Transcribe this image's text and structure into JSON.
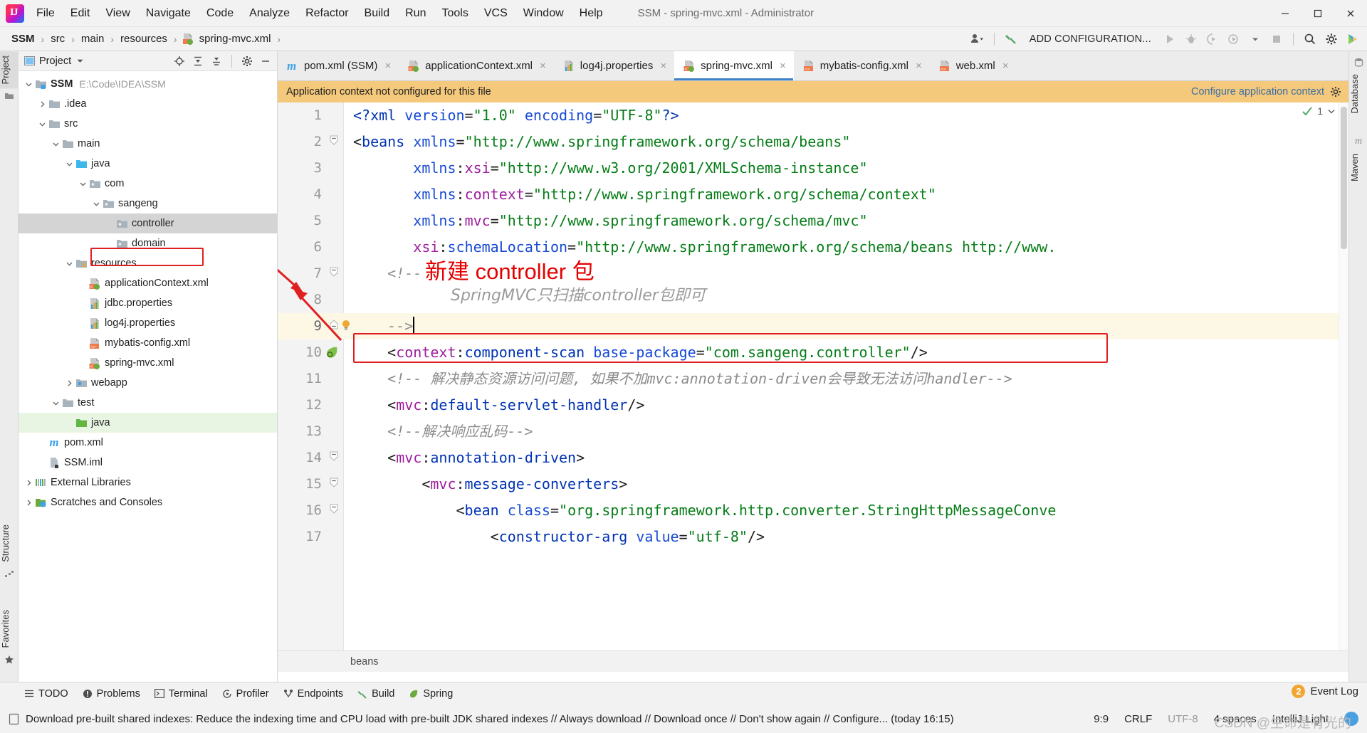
{
  "window": {
    "title": "SSM - spring-mvc.xml - Administrator",
    "logo_icon": "intellij-idea-logo",
    "minimize_icon": "minimize-icon",
    "maximize_icon": "maximize-icon",
    "close_icon": "close-icon"
  },
  "menubar": {
    "items": [
      "File",
      "Edit",
      "View",
      "Navigate",
      "Code",
      "Analyze",
      "Refactor",
      "Build",
      "Run",
      "Tools",
      "VCS",
      "Window",
      "Help"
    ]
  },
  "navbar": {
    "breadcrumbs": [
      "SSM",
      "src",
      "main",
      "resources",
      "spring-mvc.xml"
    ],
    "file_icon": "xml-spring-file-icon",
    "add_configuration_label": "ADD CONFIGURATION...",
    "icons": [
      "user-dropdown-icon",
      "hammer-build-icon",
      "run-icon",
      "debug-icon",
      "run-with-coverage-icon",
      "profile-icon",
      "stop-icon",
      "search-everywhere-icon",
      "settings-gear-icon",
      "ide-updates-icon"
    ]
  },
  "left_strip": {
    "tabs": [
      "Project",
      "Structure",
      "Favorites"
    ],
    "active_tab": "Project",
    "icons": [
      "project-folder-icon",
      "structure-icon",
      "favorites-star-icon"
    ]
  },
  "right_strip": {
    "tabs": [
      "Database",
      "Maven"
    ]
  },
  "project_panel": {
    "header_title": "Project",
    "header_icons": [
      "select-opened-file-icon",
      "expand-all-icon",
      "collapse-all-icon",
      "settings-gear-icon",
      "hide-icon"
    ],
    "tree": [
      {
        "label": "SSM",
        "path": "E:\\Code\\IDEA\\SSM",
        "depth": 0,
        "arrow": "down",
        "icon": "module-icon",
        "bold": true,
        "state": "none"
      },
      {
        "label": ".idea",
        "path": "",
        "depth": 1,
        "arrow": "right",
        "icon": "folder-icon",
        "bold": false,
        "state": "none"
      },
      {
        "label": "src",
        "path": "",
        "depth": 1,
        "arrow": "down",
        "icon": "folder-icon",
        "bold": false,
        "state": "none"
      },
      {
        "label": "main",
        "path": "",
        "depth": 2,
        "arrow": "down",
        "icon": "folder-icon",
        "bold": false,
        "state": "none"
      },
      {
        "label": "java",
        "path": "",
        "depth": 3,
        "arrow": "down",
        "icon": "source-root-icon",
        "bold": false,
        "state": "none"
      },
      {
        "label": "com",
        "path": "",
        "depth": 4,
        "arrow": "down",
        "icon": "package-icon",
        "bold": false,
        "state": "none"
      },
      {
        "label": "sangeng",
        "path": "",
        "depth": 5,
        "arrow": "down",
        "icon": "package-icon",
        "bold": false,
        "state": "none"
      },
      {
        "label": "controller",
        "path": "",
        "depth": 6,
        "arrow": "none",
        "icon": "package-icon",
        "bold": false,
        "state": "selected"
      },
      {
        "label": "domain",
        "path": "",
        "depth": 6,
        "arrow": "none",
        "icon": "package-icon",
        "bold": false,
        "state": "none"
      },
      {
        "label": "resources",
        "path": "",
        "depth": 3,
        "arrow": "down",
        "icon": "resource-root-icon",
        "bold": false,
        "state": "none"
      },
      {
        "label": "applicationContext.xml",
        "path": "",
        "depth": 4,
        "arrow": "none",
        "icon": "xml-spring-file-icon",
        "bold": false,
        "state": "none"
      },
      {
        "label": "jdbc.properties",
        "path": "",
        "depth": 4,
        "arrow": "none",
        "icon": "properties-file-icon",
        "bold": false,
        "state": "none"
      },
      {
        "label": "log4j.properties",
        "path": "",
        "depth": 4,
        "arrow": "none",
        "icon": "properties-file-icon",
        "bold": false,
        "state": "none"
      },
      {
        "label": "mybatis-config.xml",
        "path": "",
        "depth": 4,
        "arrow": "none",
        "icon": "xml-file-icon",
        "bold": false,
        "state": "none"
      },
      {
        "label": "spring-mvc.xml",
        "path": "",
        "depth": 4,
        "arrow": "none",
        "icon": "xml-spring-file-icon",
        "bold": false,
        "state": "none"
      },
      {
        "label": "webapp",
        "path": "",
        "depth": 3,
        "arrow": "right",
        "icon": "web-root-icon",
        "bold": false,
        "state": "none"
      },
      {
        "label": "test",
        "path": "",
        "depth": 2,
        "arrow": "down",
        "icon": "folder-icon",
        "bold": false,
        "state": "none"
      },
      {
        "label": "java",
        "path": "",
        "depth": 3,
        "arrow": "none",
        "icon": "test-source-root-icon",
        "bold": false,
        "state": "greensel"
      },
      {
        "label": "pom.xml",
        "path": "",
        "depth": 1,
        "arrow": "none",
        "icon": "maven-file-icon",
        "bold": false,
        "state": "none"
      },
      {
        "label": "SSM.iml",
        "path": "",
        "depth": 1,
        "arrow": "none",
        "icon": "iml-file-icon",
        "bold": false,
        "state": "none"
      },
      {
        "label": "External Libraries",
        "path": "",
        "depth": 0,
        "arrow": "right",
        "icon": "libraries-icon",
        "bold": false,
        "state": "none"
      },
      {
        "label": "Scratches and Consoles",
        "path": "",
        "depth": 0,
        "arrow": "right",
        "icon": "scratches-icon",
        "bold": false,
        "state": "none"
      }
    ]
  },
  "editor": {
    "tabs": [
      {
        "label": "pom.xml (SSM)",
        "icon": "maven-file-icon",
        "active": false
      },
      {
        "label": "applicationContext.xml",
        "icon": "xml-spring-file-icon",
        "active": false
      },
      {
        "label": "log4j.properties",
        "icon": "properties-file-icon",
        "active": false
      },
      {
        "label": "spring-mvc.xml",
        "icon": "xml-spring-file-icon",
        "active": true
      },
      {
        "label": "mybatis-config.xml",
        "icon": "xml-file-icon",
        "active": false
      },
      {
        "label": "web.xml",
        "icon": "xml-file-icon",
        "active": false
      }
    ],
    "close_glyph": "×",
    "notification": {
      "message": "Application context not configured for this file",
      "link": "Configure application context",
      "gear_icon": "settings-gear-icon"
    },
    "inspection_widget": {
      "check_icon": "inspection-ok-icon",
      "count": "1",
      "chevron_icon": "chevron-down-icon"
    },
    "lines": [
      {
        "num": "1",
        "fold": "none",
        "highlight": false,
        "tokens": [
          {
            "t": "<?xml ",
            "c": "t-prolog"
          },
          {
            "t": "version",
            "c": "t-attr"
          },
          {
            "t": "=",
            "c": "t-plain"
          },
          {
            "t": "\"1.0\"",
            "c": "t-val"
          },
          {
            "t": " ",
            "c": "t-plain"
          },
          {
            "t": "encoding",
            "c": "t-attr"
          },
          {
            "t": "=",
            "c": "t-plain"
          },
          {
            "t": "\"UTF-8\"",
            "c": "t-val"
          },
          {
            "t": "?>",
            "c": "t-prolog"
          }
        ]
      },
      {
        "num": "2",
        "fold": "open",
        "highlight": false,
        "tokens": [
          {
            "t": "<",
            "c": "t-plain"
          },
          {
            "t": "beans",
            "c": "t-tag"
          },
          {
            "t": " ",
            "c": "t-plain"
          },
          {
            "t": "xmlns",
            "c": "t-attr"
          },
          {
            "t": "=",
            "c": "t-plain"
          },
          {
            "t": "\"http://www.springframework.org/schema/beans\"",
            "c": "t-val"
          }
        ]
      },
      {
        "num": "3",
        "fold": "none",
        "highlight": false,
        "tokens": [
          {
            "t": "       ",
            "c": "t-plain"
          },
          {
            "t": "xmlns",
            "c": "t-attr"
          },
          {
            "t": ":",
            "c": "t-plain"
          },
          {
            "t": "xsi",
            "c": "t-ns"
          },
          {
            "t": "=",
            "c": "t-plain"
          },
          {
            "t": "\"http://www.w3.org/2001/XMLSchema-instance\"",
            "c": "t-val"
          }
        ]
      },
      {
        "num": "4",
        "fold": "none",
        "highlight": false,
        "tokens": [
          {
            "t": "       ",
            "c": "t-plain"
          },
          {
            "t": "xmlns",
            "c": "t-attr"
          },
          {
            "t": ":",
            "c": "t-plain"
          },
          {
            "t": "context",
            "c": "t-ns"
          },
          {
            "t": "=",
            "c": "t-plain"
          },
          {
            "t": "\"http://www.springframework.org/schema/context\"",
            "c": "t-val"
          }
        ]
      },
      {
        "num": "5",
        "fold": "none",
        "highlight": false,
        "tokens": [
          {
            "t": "       ",
            "c": "t-plain"
          },
          {
            "t": "xmlns",
            "c": "t-attr"
          },
          {
            "t": ":",
            "c": "t-plain"
          },
          {
            "t": "mvc",
            "c": "t-ns"
          },
          {
            "t": "=",
            "c": "t-plain"
          },
          {
            "t": "\"http://www.springframework.org/schema/mvc\"",
            "c": "t-val"
          }
        ]
      },
      {
        "num": "6",
        "fold": "none",
        "highlight": false,
        "tokens": [
          {
            "t": "       ",
            "c": "t-plain"
          },
          {
            "t": "xsi",
            "c": "t-ns"
          },
          {
            "t": ":",
            "c": "t-plain"
          },
          {
            "t": "schemaLocation",
            "c": "t-attr"
          },
          {
            "t": "=",
            "c": "t-plain"
          },
          {
            "t": "\"http://www.springframework.org/schema/beans http://www.",
            "c": "t-val"
          }
        ]
      },
      {
        "num": "7",
        "fold": "open",
        "highlight": false,
        "tokens": [
          {
            "t": "    <!--",
            "c": "t-comment"
          }
        ]
      },
      {
        "num": "8",
        "fold": "none",
        "highlight": false,
        "tokens": []
      },
      {
        "num": "9",
        "fold": "close",
        "bulb": true,
        "highlight": true,
        "tokens": [
          {
            "t": "    -->",
            "c": "t-comment"
          }
        ]
      },
      {
        "num": "10",
        "fold": "none",
        "spring_bean": true,
        "highlight": false,
        "tokens": [
          {
            "t": "    <",
            "c": "t-plain"
          },
          {
            "t": "context",
            "c": "t-ns"
          },
          {
            "t": ":",
            "c": "t-plain"
          },
          {
            "t": "component-scan",
            "c": "t-tag"
          },
          {
            "t": " ",
            "c": "t-plain"
          },
          {
            "t": "base-package",
            "c": "t-attr"
          },
          {
            "t": "=",
            "c": "t-plain"
          },
          {
            "t": "\"com.sangeng.controller\"",
            "c": "t-val"
          },
          {
            "t": "/>",
            "c": "t-plain"
          }
        ]
      },
      {
        "num": "11",
        "fold": "none",
        "highlight": false,
        "tokens": [
          {
            "t": "    <!-- 解决静态资源访问问题, 如果不加mvc:annotation-driven会导致无法访问handler-->",
            "c": "t-comment"
          }
        ]
      },
      {
        "num": "12",
        "fold": "none",
        "highlight": false,
        "tokens": [
          {
            "t": "    <",
            "c": "t-plain"
          },
          {
            "t": "mvc",
            "c": "t-ns"
          },
          {
            "t": ":",
            "c": "t-plain"
          },
          {
            "t": "default-servlet-handler",
            "c": "t-tag"
          },
          {
            "t": "/>",
            "c": "t-plain"
          }
        ]
      },
      {
        "num": "13",
        "fold": "none",
        "highlight": false,
        "tokens": [
          {
            "t": "    <!--解决响应乱码-->",
            "c": "t-comment"
          }
        ]
      },
      {
        "num": "14",
        "fold": "open",
        "highlight": false,
        "tokens": [
          {
            "t": "    <",
            "c": "t-plain"
          },
          {
            "t": "mvc",
            "c": "t-ns"
          },
          {
            "t": ":",
            "c": "t-plain"
          },
          {
            "t": "annotation-driven",
            "c": "t-tag"
          },
          {
            "t": ">",
            "c": "t-plain"
          }
        ]
      },
      {
        "num": "15",
        "fold": "open",
        "highlight": false,
        "tokens": [
          {
            "t": "        <",
            "c": "t-plain"
          },
          {
            "t": "mvc",
            "c": "t-ns"
          },
          {
            "t": ":",
            "c": "t-plain"
          },
          {
            "t": "message-converters",
            "c": "t-tag"
          },
          {
            "t": ">",
            "c": "t-plain"
          }
        ]
      },
      {
        "num": "16",
        "fold": "open",
        "highlight": false,
        "tokens": [
          {
            "t": "            <",
            "c": "t-plain"
          },
          {
            "t": "bean",
            "c": "t-tag"
          },
          {
            "t": " ",
            "c": "t-plain"
          },
          {
            "t": "class",
            "c": "t-attr"
          },
          {
            "t": "=",
            "c": "t-plain"
          },
          {
            "t": "\"org.springframework.http.converter.StringHttpMessageConve",
            "c": "t-val"
          }
        ]
      },
      {
        "num": "17",
        "fold": "none",
        "highlight": false,
        "tokens": [
          {
            "t": "                <",
            "c": "t-plain"
          },
          {
            "t": "constructor-arg",
            "c": "t-tag"
          },
          {
            "t": " ",
            "c": "t-plain"
          },
          {
            "t": "value",
            "c": "t-attr"
          },
          {
            "t": "=",
            "c": "t-plain"
          },
          {
            "t": "\"utf-8\"",
            "c": "t-val"
          },
          {
            "t": "/>",
            "c": "t-plain"
          }
        ]
      }
    ],
    "bottom_breadcrumb": "beans"
  },
  "annotations": {
    "red_chinese_note": "新建 controller 包",
    "gray_comment_note": "SpringMVC只扫描controller包即可",
    "red_box_line": "10",
    "red_box_tree_item": "controller",
    "arrow_color": "#e02020"
  },
  "bottom_tool_window": {
    "items": [
      {
        "label": "TODO",
        "icon": "todo-icon"
      },
      {
        "label": "Problems",
        "icon": "problems-icon"
      },
      {
        "label": "Terminal",
        "icon": "terminal-icon"
      },
      {
        "label": "Profiler",
        "icon": "profiler-icon"
      },
      {
        "label": "Endpoints",
        "icon": "endpoints-icon"
      },
      {
        "label": "Build",
        "icon": "build-hammer-icon"
      },
      {
        "label": "Spring",
        "icon": "spring-leaf-icon"
      }
    ]
  },
  "status_bar": {
    "message": "Download pre-built shared indexes: Reduce the indexing time and CPU load with pre-built JDK shared indexes // Always download // Download once // Don't show again // Configure... (today 16:15)",
    "message_icon": "info-document-icon",
    "caret_position": "9:9",
    "line_separator": "CRLF",
    "encoding": "UTF-8",
    "indent": "4 spaces",
    "indent_note": "?",
    "theme_note": "IntelliJ Light",
    "event_log": {
      "label": "Event Log",
      "count": "2"
    },
    "watermark": "CSDN @生命是有光的"
  },
  "colors": {
    "accent_blue": "#4083c9",
    "notification_bg": "#f5c97b",
    "annotation_red": "#e40000",
    "selection_gray": "#d4d4d4",
    "green_selection": "#e8f5e2",
    "highlight_line": "#fdf8e6"
  }
}
